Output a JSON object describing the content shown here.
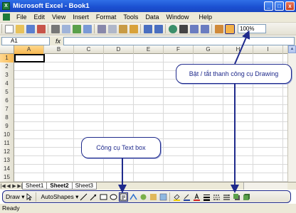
{
  "window": {
    "title": "Microsoft Excel - Book1",
    "app_icon_letter": "X"
  },
  "window_controls": {
    "minimize": "_",
    "maximize": "□",
    "close": "x"
  },
  "menu": [
    "File",
    "Edit",
    "View",
    "Insert",
    "Format",
    "Tools",
    "Data",
    "Window",
    "Help"
  ],
  "toolbar": {
    "zoom": "100%"
  },
  "formula_bar": {
    "name_box": "A1",
    "fx": "fx"
  },
  "columns": [
    "A",
    "B",
    "C",
    "D",
    "E",
    "F",
    "G",
    "H",
    "I"
  ],
  "rows": [
    "1",
    "2",
    "3",
    "4",
    "5",
    "6",
    "7",
    "8",
    "9",
    "10",
    "11",
    "12",
    "13",
    "14",
    "15"
  ],
  "sheet_nav": [
    "|◀",
    "◀",
    "▶",
    "▶|"
  ],
  "sheets": [
    "Sheet1",
    "Sheet2",
    "Sheet3"
  ],
  "active_sheet": "Sheet2",
  "drawing_toolbar": {
    "draw": "Draw ▾",
    "autoshapes": "AutoShapes ▾"
  },
  "status": "Ready",
  "callouts": {
    "drawing": "Bật / tắt thanh công cụ Drawing",
    "textbox": "Công cụ Text box"
  },
  "colors": {
    "title_bar": "#1b4fd1",
    "annotation": "#1f2a8c",
    "selection": "#f7b850"
  }
}
